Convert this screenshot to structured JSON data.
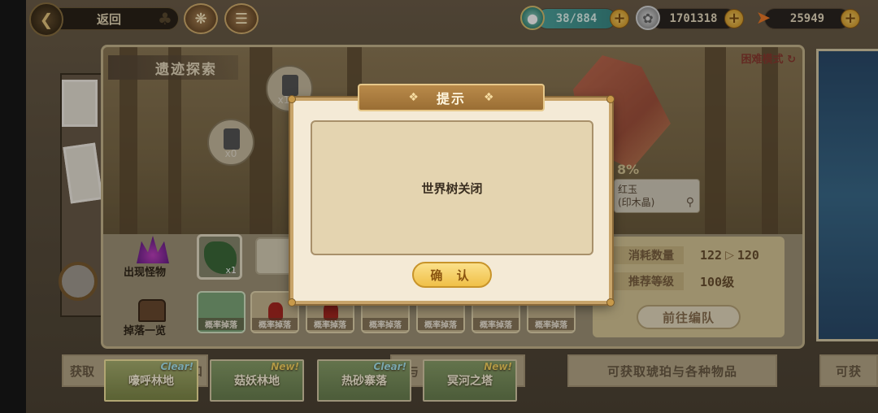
{
  "topbar": {
    "back_label": "返回",
    "energy": "38/884",
    "silver": "1701318",
    "carrot": "25949"
  },
  "panel": {
    "title": "遗迹探索",
    "mode": "困难模式",
    "stone_1_count": "x1",
    "stone_2_count": "x0",
    "drop_percent": "8%",
    "item_name": "红玉",
    "item_sub": "(印木晶)",
    "consume_label": "消耗数量",
    "consume_from": "122",
    "consume_to": "120",
    "level_label": "推荐等级",
    "level_value": "100级",
    "go_button": "前往编队",
    "monster_label": "出现怪物",
    "monster_count": "x1",
    "drop_label": "掉落一览",
    "drop_slots": [
      "概率掉落",
      "概率掉落",
      "概率掉落",
      "概率掉落",
      "概率掉落",
      "概率掉落",
      "概率掉落"
    ]
  },
  "bottom": {
    "left_text": "获取",
    "left_text_2": "和",
    "mid_text": "与",
    "right_text": "可获取琥珀与各种物品",
    "far_right_text": "可获",
    "tabs": [
      {
        "label": "嚎呼林地",
        "tag": "Clear!"
      },
      {
        "label": "菇妖林地",
        "tag": "New!"
      },
      {
        "label": "热砂寨落",
        "tag": "Clear!"
      },
      {
        "label": "冥河之塔",
        "tag": "New!"
      }
    ]
  },
  "modal": {
    "title": "提示",
    "message": "世界树关闭",
    "confirm": "确 认"
  },
  "colors": {
    "accent": "#c8a46a",
    "confirm_button": "#f0c048",
    "energy_bar": "#4fa6a0"
  },
  "icons": {
    "back": "back-arrow-icon",
    "clover": "clover-icon",
    "compass": "compass-icon",
    "book": "book-icon",
    "potion": "potion-icon",
    "coin": "silver-coin-icon",
    "carrot": "carrot-icon",
    "refresh": "refresh-icon",
    "magnifier": "magnifier-icon"
  }
}
